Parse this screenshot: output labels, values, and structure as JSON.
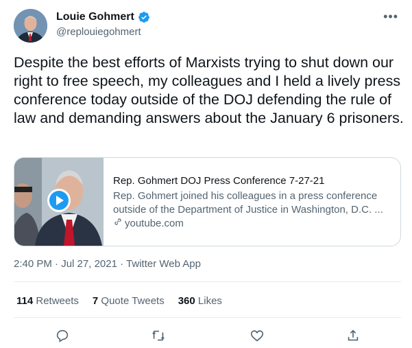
{
  "author": {
    "display_name": "Louie Gohmert",
    "handle": "@replouiegohmert",
    "verified_icon": "verified-badge-icon",
    "avatar_icon": "profile-avatar"
  },
  "more_icon": "more-options-icon",
  "tweet": {
    "text": "Despite the best efforts of Marxists trying to shut down our right to free speech, my colleagues and I held a lively press conference today outside of the DOJ defending the rule of law and demanding answers about the January 6 prisoners."
  },
  "card": {
    "title": "Rep. Gohmert DOJ Press Conference 7-27-21",
    "description": "Rep. Gohmert joined his colleagues in a press conference outside of the Department of Justice in Washington, D.C. ...",
    "domain": "youtube.com",
    "play_icon": "play-icon",
    "link_icon": "link-icon"
  },
  "meta": {
    "time": "2:40 PM",
    "date": "Jul 27, 2021",
    "source": "Twitter Web App",
    "separator": "·"
  },
  "stats": {
    "retweets_count": "114",
    "retweets_label": "Retweets",
    "quotes_count": "7",
    "quotes_label": "Quote Tweets",
    "likes_count": "360",
    "likes_label": "Likes"
  },
  "actions": [
    "reply-icon",
    "retweet-icon",
    "like-icon",
    "share-icon"
  ],
  "colors": {
    "text": "#0f1419",
    "secondary": "#536471",
    "verified": "#1d9bf0",
    "border": "#cfd9de"
  }
}
